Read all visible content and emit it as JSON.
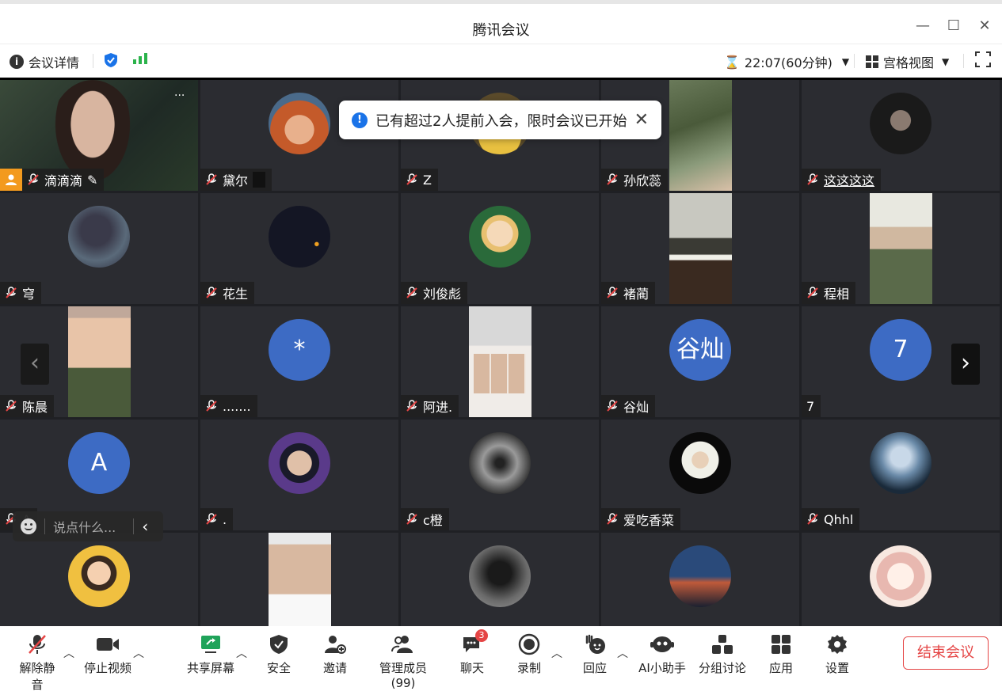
{
  "window": {
    "title": "腾讯会议",
    "minimize": "—",
    "maximize": "☐",
    "close": "✕"
  },
  "infobar": {
    "details": "会议详情",
    "timer": "22:07(60分钟)",
    "view": "宫格视图"
  },
  "toast": {
    "message": "已有超过2人提前入会，限时会议已开始"
  },
  "participants": [
    {
      "name": "滴滴滴",
      "type": "video"
    },
    {
      "name": "黛尔",
      "type": "avatar"
    },
    {
      "name": "Z",
      "type": "avatar"
    },
    {
      "name": "孙欣蕊",
      "type": "video"
    },
    {
      "name": "这这这这",
      "type": "avatar"
    },
    {
      "name": "穹",
      "type": "avatar"
    },
    {
      "name": "花生",
      "type": "avatar"
    },
    {
      "name": "刘俊彪",
      "type": "avatar"
    },
    {
      "name": "褚蔺",
      "type": "video"
    },
    {
      "name": "程相",
      "type": "video"
    },
    {
      "name": "陈晨",
      "type": "video"
    },
    {
      "name": ".......",
      "type": "letter",
      "letter": "*"
    },
    {
      "name": "阿进.",
      "type": "video"
    },
    {
      "name": "谷灿",
      "type": "letter",
      "letter": "谷灿"
    },
    {
      "name": "7",
      "type": "letter",
      "letter": "7"
    },
    {
      "name": "A",
      "type": "letter",
      "letter": "A"
    },
    {
      "name": ".",
      "type": "avatar"
    },
    {
      "name": "c橙",
      "type": "avatar"
    },
    {
      "name": "爱吃香菜",
      "type": "avatar"
    },
    {
      "name": "Qhhl",
      "type": "avatar"
    }
  ],
  "chat": {
    "placeholder": "说点什么..."
  },
  "toolbar": {
    "unmute": "解除静音",
    "stop_video": "停止视频",
    "share": "共享屏幕",
    "security": "安全",
    "invite": "邀请",
    "members": "管理成员(99)",
    "chat": "聊天",
    "chat_badge": "3",
    "record": "录制",
    "react": "回应",
    "ai": "AI小助手",
    "breakout": "分组讨论",
    "apps": "应用",
    "settings": "设置",
    "end": "结束会议"
  }
}
